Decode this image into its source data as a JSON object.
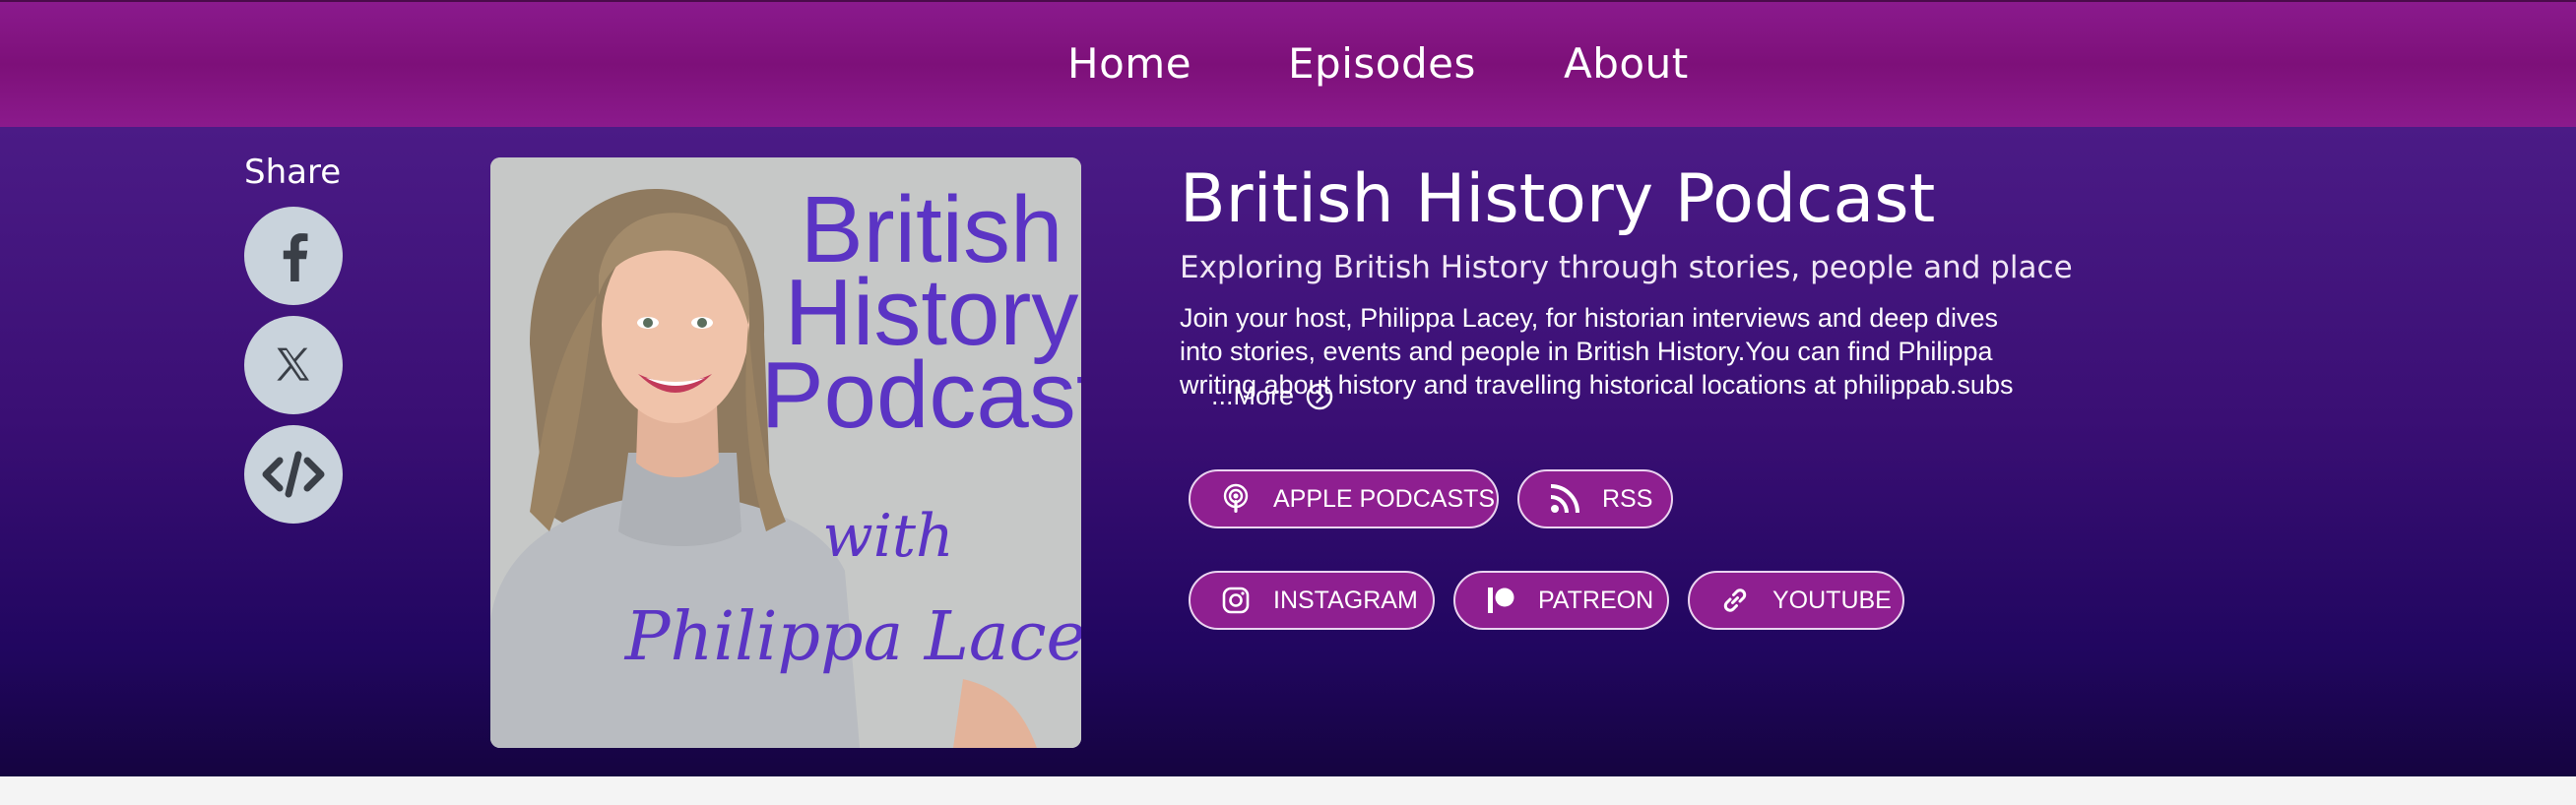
{
  "nav": {
    "items": [
      {
        "label": "Home"
      },
      {
        "label": "Episodes"
      },
      {
        "label": "About"
      }
    ]
  },
  "share": {
    "label": "Share",
    "buttons": [
      {
        "icon": "facebook-icon"
      },
      {
        "icon": "x-icon"
      },
      {
        "icon": "embed-icon"
      }
    ]
  },
  "cover": {
    "line1": "British",
    "line2": "History",
    "line3": "Podcast",
    "with": "with",
    "host": "Philippa Lacey"
  },
  "podcast": {
    "title": "British History Podcast",
    "subtitle": "Exploring British History through stories, people and place",
    "description": "Join your host, Philippa Lacey, for historian interviews and deep dives into stories, events and people in British History.You can find Philippa writing about history and travelling historical locations at philippab.subs",
    "more_label": "...More"
  },
  "links": {
    "apple": "APPLE PODCASTS",
    "rss": "RSS",
    "instagram": "INSTAGRAM",
    "patreon": "PATREON",
    "youtube": "YOUTUBE"
  },
  "colors": {
    "nav_bg": "#7d1079",
    "hero_top": "#4b1b86",
    "hero_bottom": "#150440",
    "pill_bg": "#8e1f90",
    "cover_text": "#5b34c4",
    "share_btn": "#c9d3dc"
  }
}
